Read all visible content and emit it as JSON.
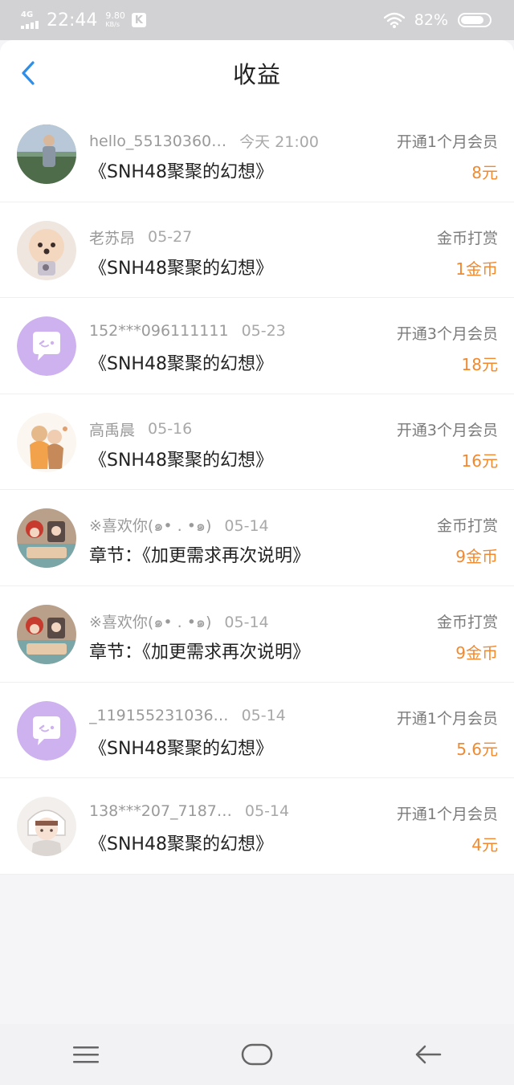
{
  "status_bar": {
    "network": "4G",
    "time": "22:44",
    "speed_value": "9.80",
    "speed_unit": "KB/s",
    "app_badge": "K",
    "battery": "82%",
    "battery_level": 0.82
  },
  "header": {
    "title": "收益",
    "back_icon": "chevron-left-icon"
  },
  "colors": {
    "accent": "#2f8ee8",
    "amount": "#f2892e",
    "status_bar": "#d2d2d4"
  },
  "earnings": [
    {
      "nickname": "hello_55130360…",
      "date": "今天 21:00",
      "type": "开通1个月会员",
      "title": "《SNH48聚聚的幻想》",
      "amount": "8元",
      "avatar": "photo-avatar"
    },
    {
      "nickname": "老苏昂",
      "date": "05-27",
      "type": "金币打赏",
      "title": "《SNH48聚聚的幻想》",
      "amount": "1金币",
      "avatar": "puppy-avatar"
    },
    {
      "nickname": "152***096111111",
      "date": "05-23",
      "type": "开通3个月会员",
      "title": "《SNH48聚聚的幻想》",
      "amount": "18元",
      "avatar": "default-chat-avatar"
    },
    {
      "nickname": "高禹晨",
      "date": "05-16",
      "type": "开通3个月会员",
      "title": "《SNH48聚聚的幻想》",
      "amount": "16元",
      "avatar": "illustration-avatar"
    },
    {
      "nickname": "※喜欢你(๑• . •๑)",
      "date": "05-14",
      "type": "金币打赏",
      "title": "章节：《加更需求再次说明》",
      "amount": "9金币",
      "avatar": "anime-avatar"
    },
    {
      "nickname": "※喜欢你(๑• . •๑)",
      "date": "05-14",
      "type": "金币打赏",
      "title": "章节：《加更需求再次说明》",
      "amount": "9金币",
      "avatar": "anime-avatar"
    },
    {
      "nickname": "_119155231036…",
      "date": "05-14",
      "type": "开通1个月会员",
      "title": "《SNH48聚聚的幻想》",
      "amount": "5.6元",
      "avatar": "default-chat-avatar"
    },
    {
      "nickname": "138***207_7187…",
      "date": "05-14",
      "type": "开通1个月会员",
      "title": "《SNH48聚聚的幻想》",
      "amount": "4元",
      "avatar": "sketch-avatar"
    }
  ],
  "nav": {
    "menu_icon": "menu-icon",
    "home_icon": "home-icon",
    "back_icon": "back-arrow-icon"
  }
}
